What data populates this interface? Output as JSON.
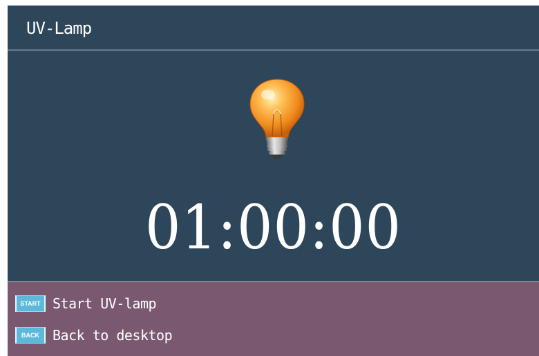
{
  "window": {
    "title": "UV-Lamp"
  },
  "lamp": {
    "icon": "light-bulb-icon",
    "timer": "01:00:00"
  },
  "actions": [
    {
      "badge": "START",
      "label": "Start UV-lamp"
    },
    {
      "badge": "BACK",
      "label": "Back to desktop"
    }
  ],
  "colors": {
    "background": "#2e4659",
    "footer": "#7a5970",
    "badge": "#5bb9dc",
    "text": "#ffffff"
  }
}
